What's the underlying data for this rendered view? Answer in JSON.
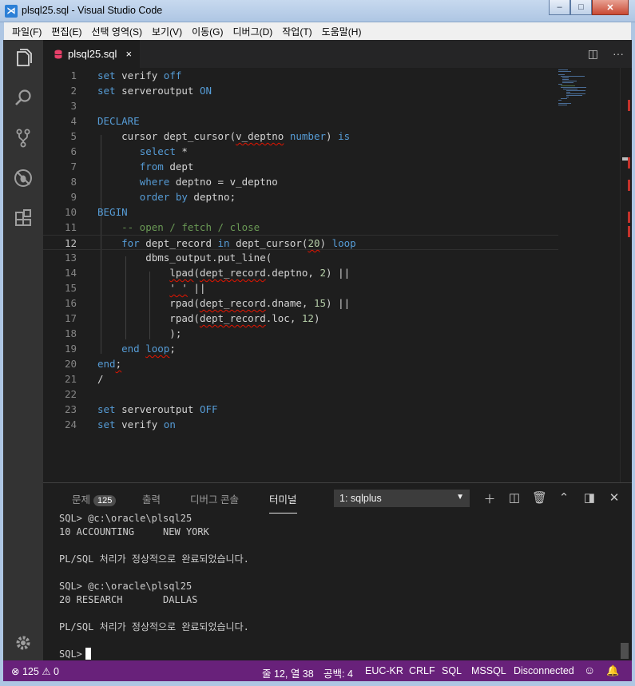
{
  "window": {
    "title": "plsql25.sql - Visual Studio Code",
    "minimize": "‒",
    "maximize": "□",
    "close": "✕"
  },
  "menu": [
    "파일(F)",
    "편집(E)",
    "선택 영역(S)",
    "보기(V)",
    "이동(G)",
    "디버그(D)",
    "작업(T)",
    "도움말(H)"
  ],
  "activity": [
    "explorer-icon",
    "search-icon",
    "source-control-icon",
    "debug-icon",
    "extensions-icon",
    "gear-icon"
  ],
  "tab": {
    "label": "plsql25.sql",
    "close": "×"
  },
  "editor_actions": {
    "split": "◫",
    "more": "···"
  },
  "editor": {
    "current_line": 12,
    "lines": [
      "set verify off",
      "set serveroutput ON",
      "",
      "DECLARE",
      "    cursor dept_cursor(v_deptno number) is",
      "       select *",
      "       from dept",
      "       where deptno = v_deptno",
      "       order by deptno;",
      "BEGIN",
      "    -- open / fetch / close",
      "    for dept_record in dept_cursor(20) loop",
      "        dbms_output.put_line(",
      "            lpad(dept_record.deptno, 2) ||",
      "            ' ' ||",
      "            rpad(dept_record.dname, 15) ||",
      "            rpad(dept_record.loc, 12)",
      "            );",
      "    end loop;",
      "end;",
      "/",
      "",
      "set serveroutput OFF",
      "set verify on"
    ]
  },
  "panel": {
    "tabs": [
      {
        "label": "문제",
        "badge": "125"
      },
      {
        "label": "출력"
      },
      {
        "label": "디버그 콘솔"
      },
      {
        "label": "터미널",
        "active": true
      }
    ],
    "terminal_select": "1: sqlplus",
    "icons": [
      "add-icon",
      "split-icon",
      "trash-icon",
      "chevron-up-icon",
      "maximize-icon",
      "close-icon"
    ],
    "terminal_lines": [
      "SQL> @c:\\oracle\\plsql25",
      "10 ACCOUNTING     NEW YORK",
      "",
      "PL/SQL 처리가 정상적으로 완료되었습니다.",
      "",
      "SQL> @c:\\oracle\\plsql25",
      "20 RESEARCH       DALLAS",
      "",
      "PL/SQL 처리가 정상적으로 완료되었습니다.",
      "",
      "SQL>"
    ]
  },
  "status": {
    "errors": "125",
    "warnings": "0",
    "position": "줄 12, 열 38",
    "indent": "공백: 4",
    "encoding": "EUC-KR",
    "eol": "CRLF",
    "language": "SQL",
    "connection_type": "MSSQL",
    "connection_state": "Disconnected"
  }
}
